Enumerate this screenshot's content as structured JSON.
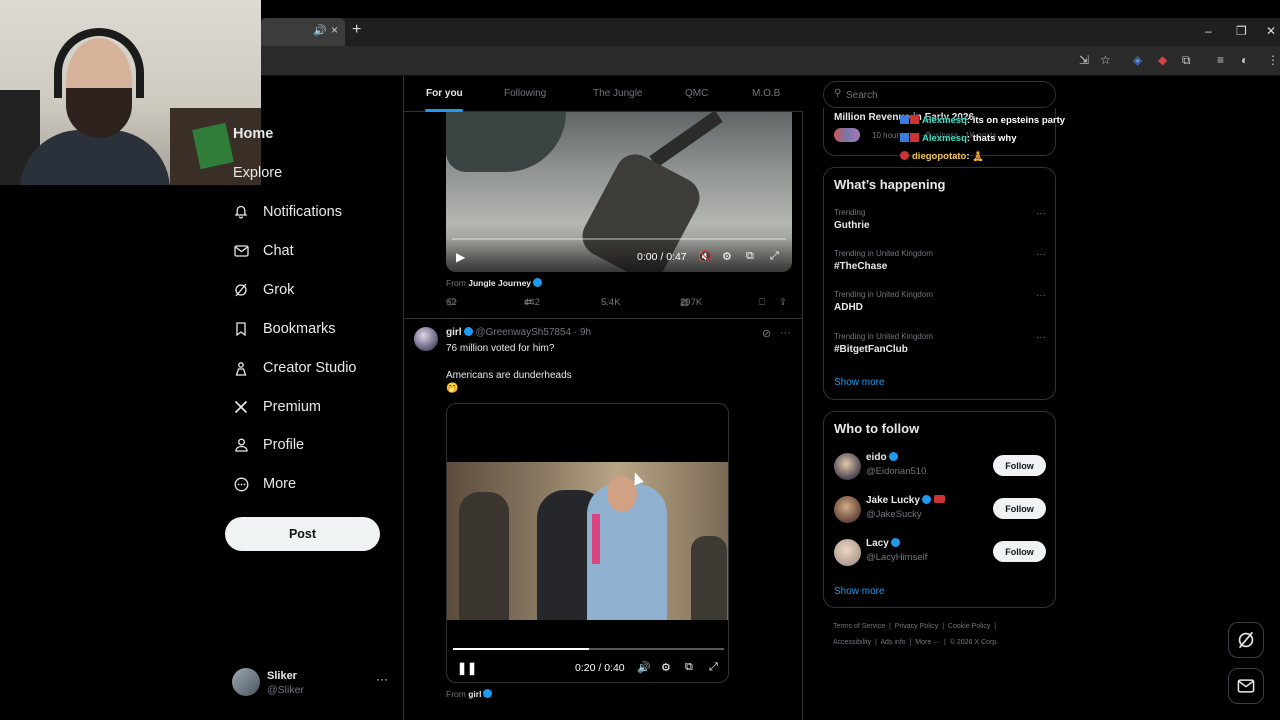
{
  "browser": {
    "speaker_icon": "speaker-icon",
    "tab_close": "×",
    "new_tab": "+"
  },
  "nav": {
    "items": [
      {
        "label": "Home",
        "icon": "home-icon"
      },
      {
        "label": "Explore",
        "icon": "search-icon"
      },
      {
        "label": "Notifications",
        "icon": "bell-icon"
      },
      {
        "label": "Chat",
        "icon": "mail-icon"
      },
      {
        "label": "Grok",
        "icon": "grok-icon"
      },
      {
        "label": "Bookmarks",
        "icon": "bookmark-icon"
      },
      {
        "label": "Creator Studio",
        "icon": "creator-icon"
      },
      {
        "label": "Premium",
        "icon": "x-logo-icon"
      },
      {
        "label": "Profile",
        "icon": "person-icon"
      },
      {
        "label": "More",
        "icon": "more-circle-icon"
      }
    ],
    "post_label": "Post",
    "account": {
      "name": "Sliker",
      "handle": "@Sliker",
      "menu": "···"
    }
  },
  "feed": {
    "tabs": [
      "For you",
      "Following",
      "The Jungle",
      "QMC",
      "M.O.B"
    ],
    "active_tab": "For you",
    "tweet1": {
      "video_time": "0:00 / 0:47",
      "from_label": "From",
      "from_name": "Jungle Journey",
      "replies": "62",
      "retweets": "442",
      "likes": "5.4K",
      "views": "297K"
    },
    "tweet2": {
      "name": "girl",
      "handle_time": "@GreenwaySh57854 · 9h",
      "line1": "76 million voted for him?",
      "line2": "Americans are dunderheads",
      "emoji": "🤭",
      "video_time": "0:20 / 0:40",
      "progress": 0.5,
      "from_label": "From",
      "from_name": "girl"
    }
  },
  "sidebar": {
    "search_placeholder": "Search",
    "top_card": {
      "title": "Million Revenue in Early 2026",
      "meta": "10 hours ago · Business · 1K posts"
    },
    "whats_happening": {
      "title": "What’s happening",
      "trends": [
        {
          "context": "Trending",
          "name": "Guthrie"
        },
        {
          "context": "Trending in United Kingdom",
          "name": "#TheChase"
        },
        {
          "context": "Trending in United Kingdom",
          "name": "ADHD"
        },
        {
          "context": "Trending in United Kingdom",
          "name": "#BitgetFanClub"
        }
      ],
      "show_more": "Show more"
    },
    "who_to_follow": {
      "title": "Who to follow",
      "users": [
        {
          "name": "eido",
          "handle": "@Eidorian510",
          "follow": "Follow"
        },
        {
          "name": "Jake Lucky",
          "handle": "@JakeSucky",
          "follow": "Follow"
        },
        {
          "name": "Lacy",
          "handle": "@LacyHimself",
          "follow": "Follow"
        }
      ],
      "show_more": "Show more"
    },
    "footer": {
      "line1": [
        "Terms of Service",
        "|",
        "Privacy Policy",
        "|",
        "Cookie Policy",
        "|"
      ],
      "line2": [
        "Accessibility",
        "|",
        "Ads info",
        "|",
        "More ···",
        "|",
        "© 2026 X Corp."
      ]
    }
  },
  "chat": [
    {
      "user": "Alexmesq",
      "msg": ": its on epsteins party",
      "color": "#3fe0c8"
    },
    {
      "user": "Alexmesq",
      "msg": ": thats why",
      "color": "#3fe0c8"
    },
    {
      "user": "diegopotato",
      "msg": ":",
      "color": "#f2c94c"
    }
  ],
  "colors": {
    "accent": "#1d9bf0",
    "bg": "#000000",
    "border": "#2f3336",
    "muted": "#71767b"
  }
}
